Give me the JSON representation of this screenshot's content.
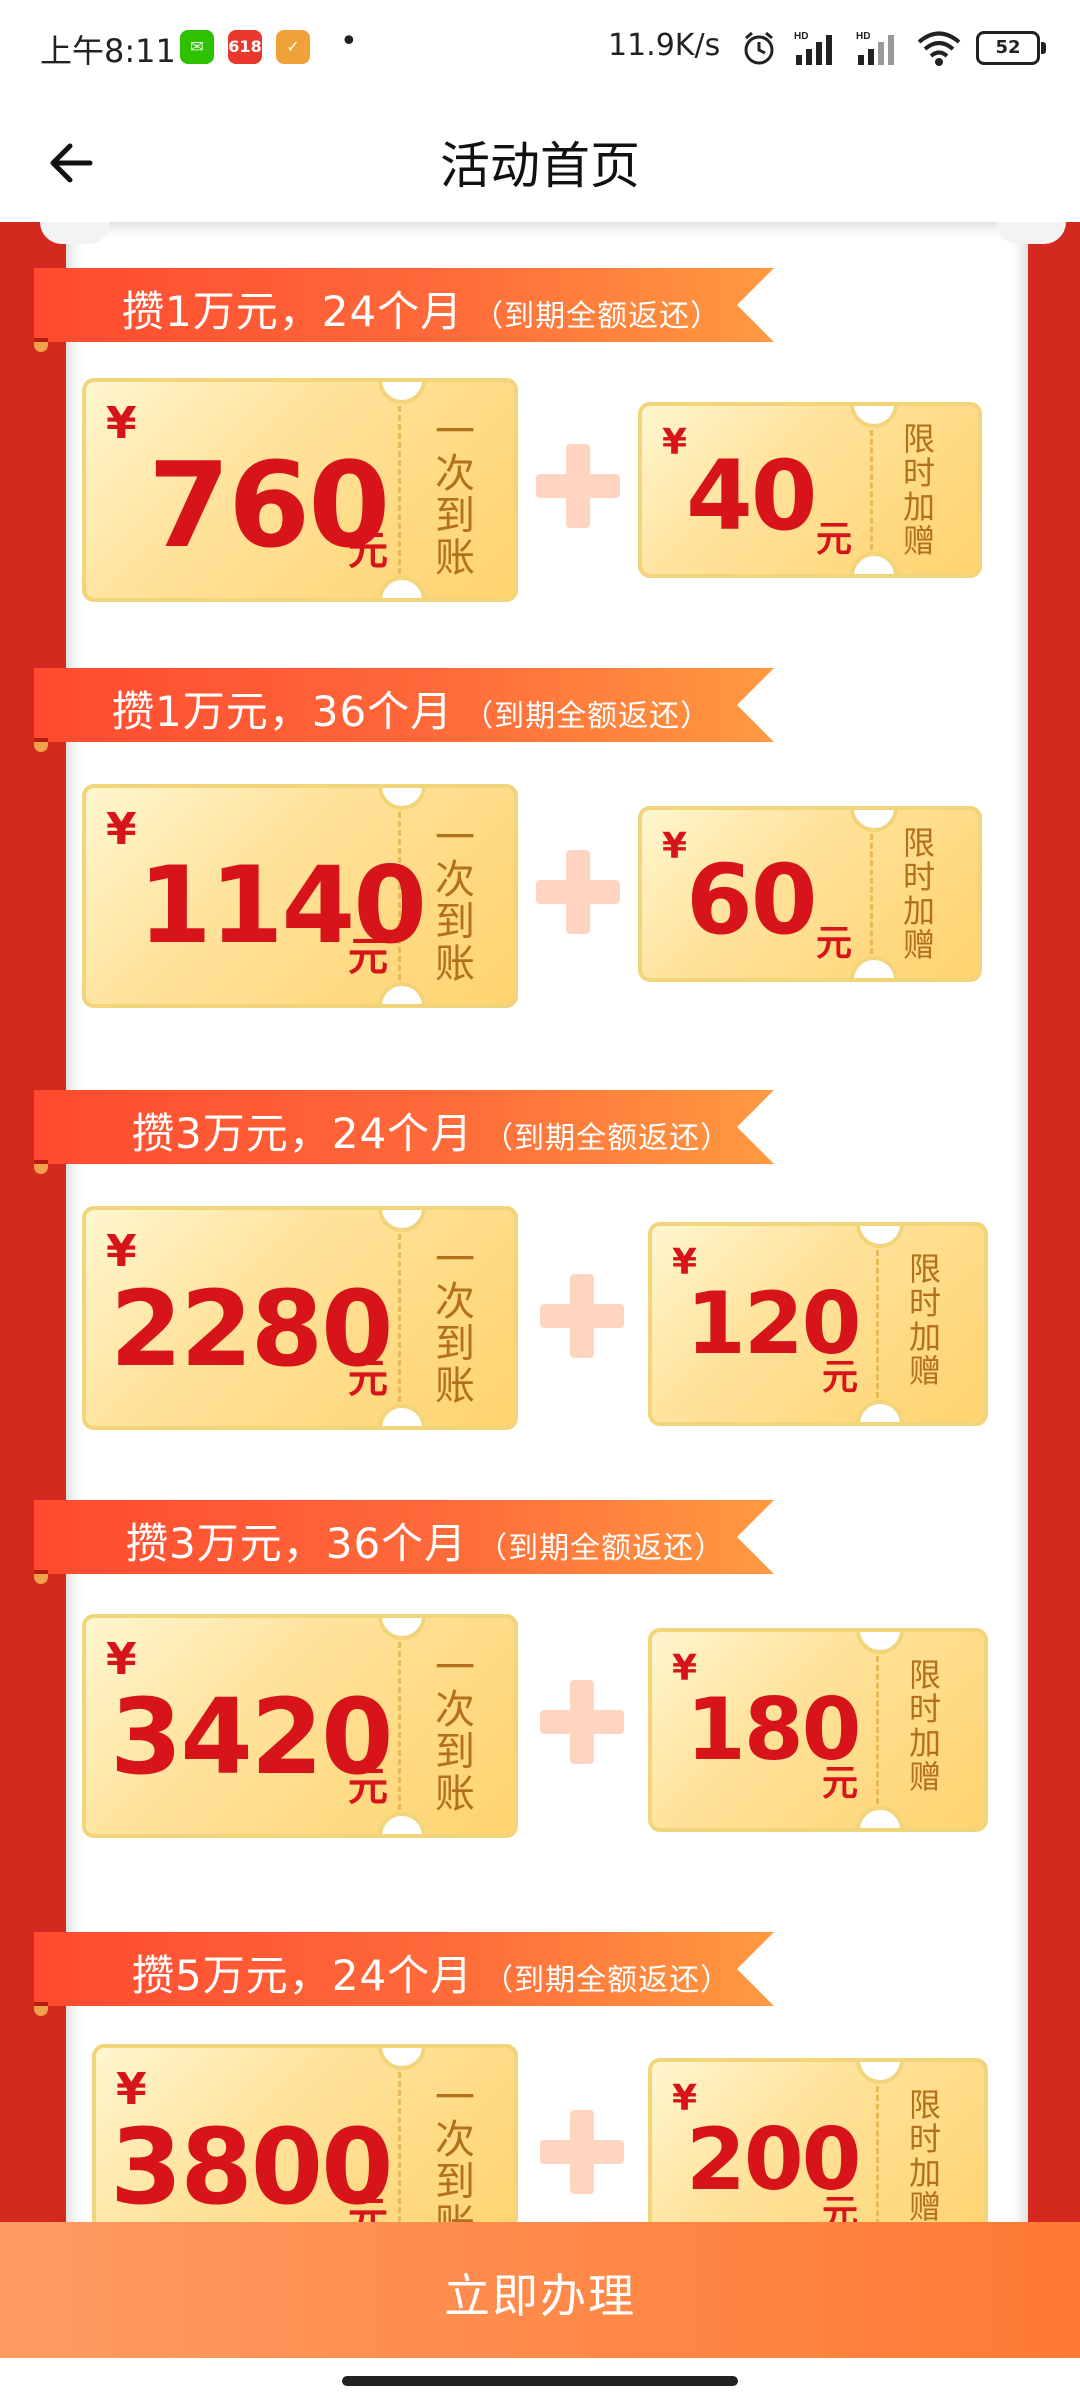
{
  "status_bar": {
    "time": "上午8:11",
    "app_icons": [
      {
        "name": "wechat-icon",
        "color": "#2dc100"
      },
      {
        "name": "taobao-618-icon",
        "label": "618",
        "color": "#e8382c"
      },
      {
        "name": "orange-app-icon",
        "color": "#f0a13a"
      }
    ],
    "dot": "•",
    "network_speed": "11.9K/s",
    "battery": "52"
  },
  "nav": {
    "title": "活动首页"
  },
  "offers": [
    {
      "banner_main": "攒1万元，24个月",
      "banner_sub": "（到期全额返还）",
      "currency": "¥",
      "main_amount": "760",
      "main_unit": "元",
      "main_note": "一次到账",
      "bonus_amount": "40",
      "bonus_unit": "元",
      "bonus_note": "限时加赠"
    },
    {
      "banner_main": "攒1万元，36个月",
      "banner_sub": "（到期全额返还）",
      "currency": "¥",
      "main_amount": "1140",
      "main_unit": "元",
      "main_note": "一次到账",
      "bonus_amount": "60",
      "bonus_unit": "元",
      "bonus_note": "限时加赠"
    },
    {
      "banner_main": "攒3万元，24个月",
      "banner_sub": "（到期全额返还）",
      "currency": "¥",
      "main_amount": "2280",
      "main_unit": "元",
      "main_note": "一次到账",
      "bonus_amount": "120",
      "bonus_unit": "元",
      "bonus_note": "限时加赠"
    },
    {
      "banner_main": "攒3万元，36个月",
      "banner_sub": "（到期全额返还）",
      "currency": "¥",
      "main_amount": "3420",
      "main_unit": "元",
      "main_note": "一次到账",
      "bonus_amount": "180",
      "bonus_unit": "元",
      "bonus_note": "限时加赠"
    },
    {
      "banner_main": "攒5万元，24个月",
      "banner_sub": "（到期全额返还）",
      "currency": "¥",
      "main_amount": "3800",
      "main_unit": "元",
      "main_note": "一次到账",
      "bonus_amount": "200",
      "bonus_unit": "元",
      "bonus_note": "限时加赠"
    }
  ],
  "action_button": {
    "label": "立即办理"
  },
  "colors": {
    "frame_red": "#d4291f",
    "amount_red": "#d7141a",
    "button_orange": "#ff8a4a"
  }
}
